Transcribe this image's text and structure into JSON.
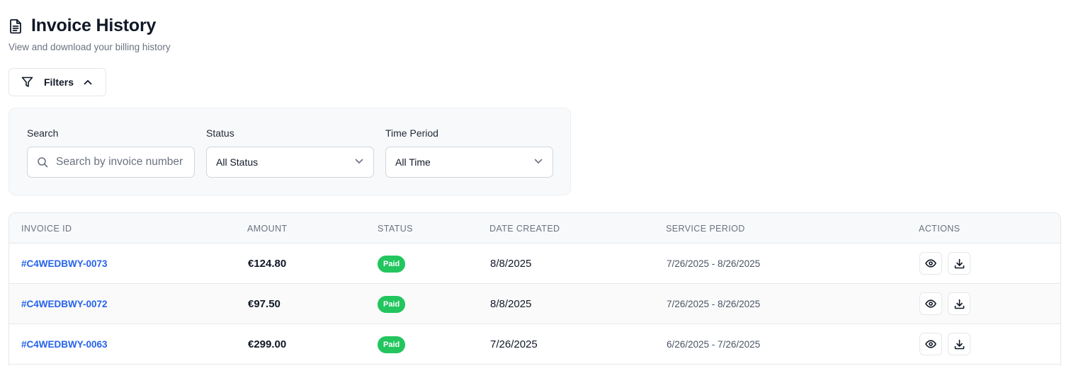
{
  "header": {
    "title": "Invoice History",
    "subtitle": "View and download your billing history",
    "icon": "document-icon"
  },
  "filters": {
    "toggle_label": "Filters",
    "search": {
      "label": "Search",
      "placeholder": "Search by invoice number",
      "value": ""
    },
    "status": {
      "label": "Status",
      "selected": "All Status"
    },
    "time_period": {
      "label": "Time Period",
      "selected": "All Time"
    }
  },
  "table": {
    "columns": [
      "INVOICE ID",
      "AMOUNT",
      "STATUS",
      "DATE CREATED",
      "SERVICE PERIOD",
      "ACTIONS"
    ],
    "rows": [
      {
        "id": "#C4WEDBWY-0073",
        "amount": "€124.80",
        "status": "Paid",
        "date": "8/8/2025",
        "period": "7/26/2025 - 8/26/2025"
      },
      {
        "id": "#C4WEDBWY-0072",
        "amount": "€97.50",
        "status": "Paid",
        "date": "8/8/2025",
        "period": "7/26/2025 - 8/26/2025"
      },
      {
        "id": "#C4WEDBWY-0063",
        "amount": "€299.00",
        "status": "Paid",
        "date": "7/26/2025",
        "period": "6/26/2025 - 7/26/2025"
      }
    ]
  },
  "colors": {
    "link": "#2563eb",
    "paid_badge": "#22c55e",
    "panel_bg": "#f8f9fb",
    "border": "#e5e7eb"
  }
}
